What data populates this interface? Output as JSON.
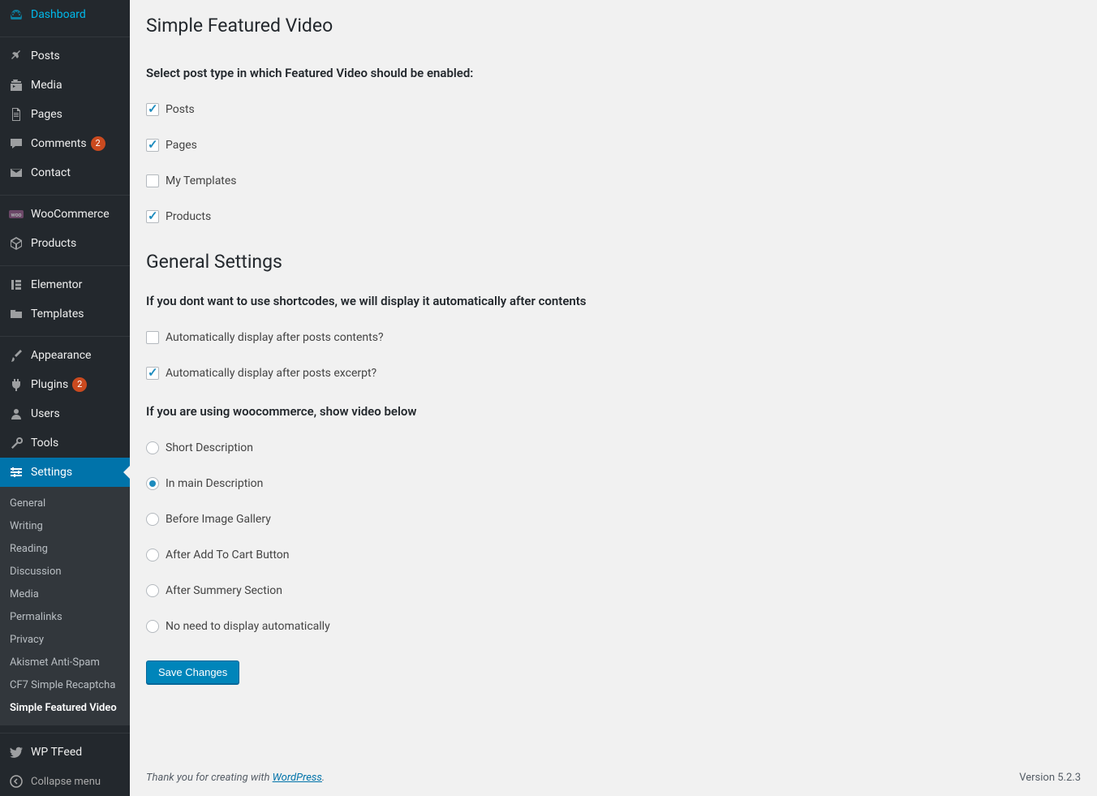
{
  "sidebar": {
    "items": [
      {
        "label": "Dashboard",
        "icon": "dashboard"
      },
      {
        "label": "Posts",
        "icon": "pin"
      },
      {
        "label": "Media",
        "icon": "media"
      },
      {
        "label": "Pages",
        "icon": "page"
      },
      {
        "label": "Comments",
        "icon": "comment",
        "badge": "2"
      },
      {
        "label": "Contact",
        "icon": "mail"
      },
      {
        "label": "WooCommerce",
        "icon": "woo"
      },
      {
        "label": "Products",
        "icon": "product"
      },
      {
        "label": "Elementor",
        "icon": "elementor"
      },
      {
        "label": "Templates",
        "icon": "folder"
      },
      {
        "label": "Appearance",
        "icon": "brush"
      },
      {
        "label": "Plugins",
        "icon": "plug",
        "badge": "2"
      },
      {
        "label": "Users",
        "icon": "user"
      },
      {
        "label": "Tools",
        "icon": "wrench"
      },
      {
        "label": "Settings",
        "icon": "settings",
        "active": true
      },
      {
        "label": "WP TFeed",
        "icon": "twitter"
      }
    ],
    "submenu": [
      "General",
      "Writing",
      "Reading",
      "Discussion",
      "Media",
      "Permalinks",
      "Privacy",
      "Akismet Anti-Spam",
      "CF7 Simple Recaptcha",
      "Simple Featured Video"
    ],
    "collapse_label": "Collapse menu"
  },
  "page": {
    "title": "Simple Featured Video",
    "post_type_heading": "Select post type in which Featured Video should be enabled:",
    "post_types": [
      {
        "label": "Posts",
        "checked": true
      },
      {
        "label": "Pages",
        "checked": true
      },
      {
        "label": "My Templates",
        "checked": false
      },
      {
        "label": "Products",
        "checked": true
      }
    ],
    "general_heading": "General Settings",
    "auto_display_heading": "If you dont want to use shortcodes, we will display it automatically after contents",
    "auto_display": [
      {
        "label": "Automatically display after posts contents?",
        "checked": false
      },
      {
        "label": "Automatically display after posts excerpt?",
        "checked": true
      }
    ],
    "woo_heading": "If you are using woocommerce, show video below",
    "woo_options": [
      {
        "label": "Short Description",
        "selected": false
      },
      {
        "label": "In main Description",
        "selected": true
      },
      {
        "label": "Before Image Gallery",
        "selected": false
      },
      {
        "label": "After Add To Cart Button",
        "selected": false
      },
      {
        "label": "After Summery Section",
        "selected": false
      },
      {
        "label": "No need to display automatically",
        "selected": false
      }
    ],
    "save_label": "Save Changes"
  },
  "footer": {
    "thanks_prefix": "Thank you for creating with ",
    "link_text": "WordPress",
    "thanks_suffix": ".",
    "version": "Version 5.2.3"
  }
}
